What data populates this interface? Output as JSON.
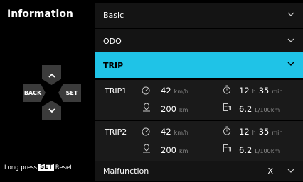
{
  "left": {
    "title": "Information",
    "keys": {
      "back": "BACK",
      "set": "SET"
    },
    "hint": {
      "prefix": "Long press",
      "badge": "SET",
      "suffix": "Reset"
    }
  },
  "menu": {
    "basic": "Basic",
    "odo": "ODO",
    "trip": "TRIP",
    "malfunction": "Malfunction",
    "malfunction_value": "X"
  },
  "trips": [
    {
      "label": "TRIP1",
      "speed": "42",
      "speed_unit": "km/h",
      "time_h": "12",
      "h_unit": "h",
      "time_min": "35",
      "min_unit": "min",
      "distance": "200",
      "distance_unit": "km",
      "fuel": "6.2",
      "fuel_unit": "L/100km"
    },
    {
      "label": "TRIP2",
      "speed": "42",
      "speed_unit": "km/h",
      "time_h": "12",
      "h_unit": "h",
      "time_min": "35",
      "min_unit": "min",
      "distance": "200",
      "distance_unit": "km",
      "fuel": "6.2",
      "fuel_unit": "L/100km"
    }
  ],
  "colors": {
    "accent": "#1fc3e7",
    "background": "#000000",
    "row": "#141414",
    "unit": "#8a8a8a"
  },
  "icons": {
    "expand": "chevron-down-icon",
    "speed": "speedometer-icon",
    "time": "stopwatch-icon",
    "distance": "location-pin-icon",
    "fuel": "fuel-pump-icon"
  }
}
